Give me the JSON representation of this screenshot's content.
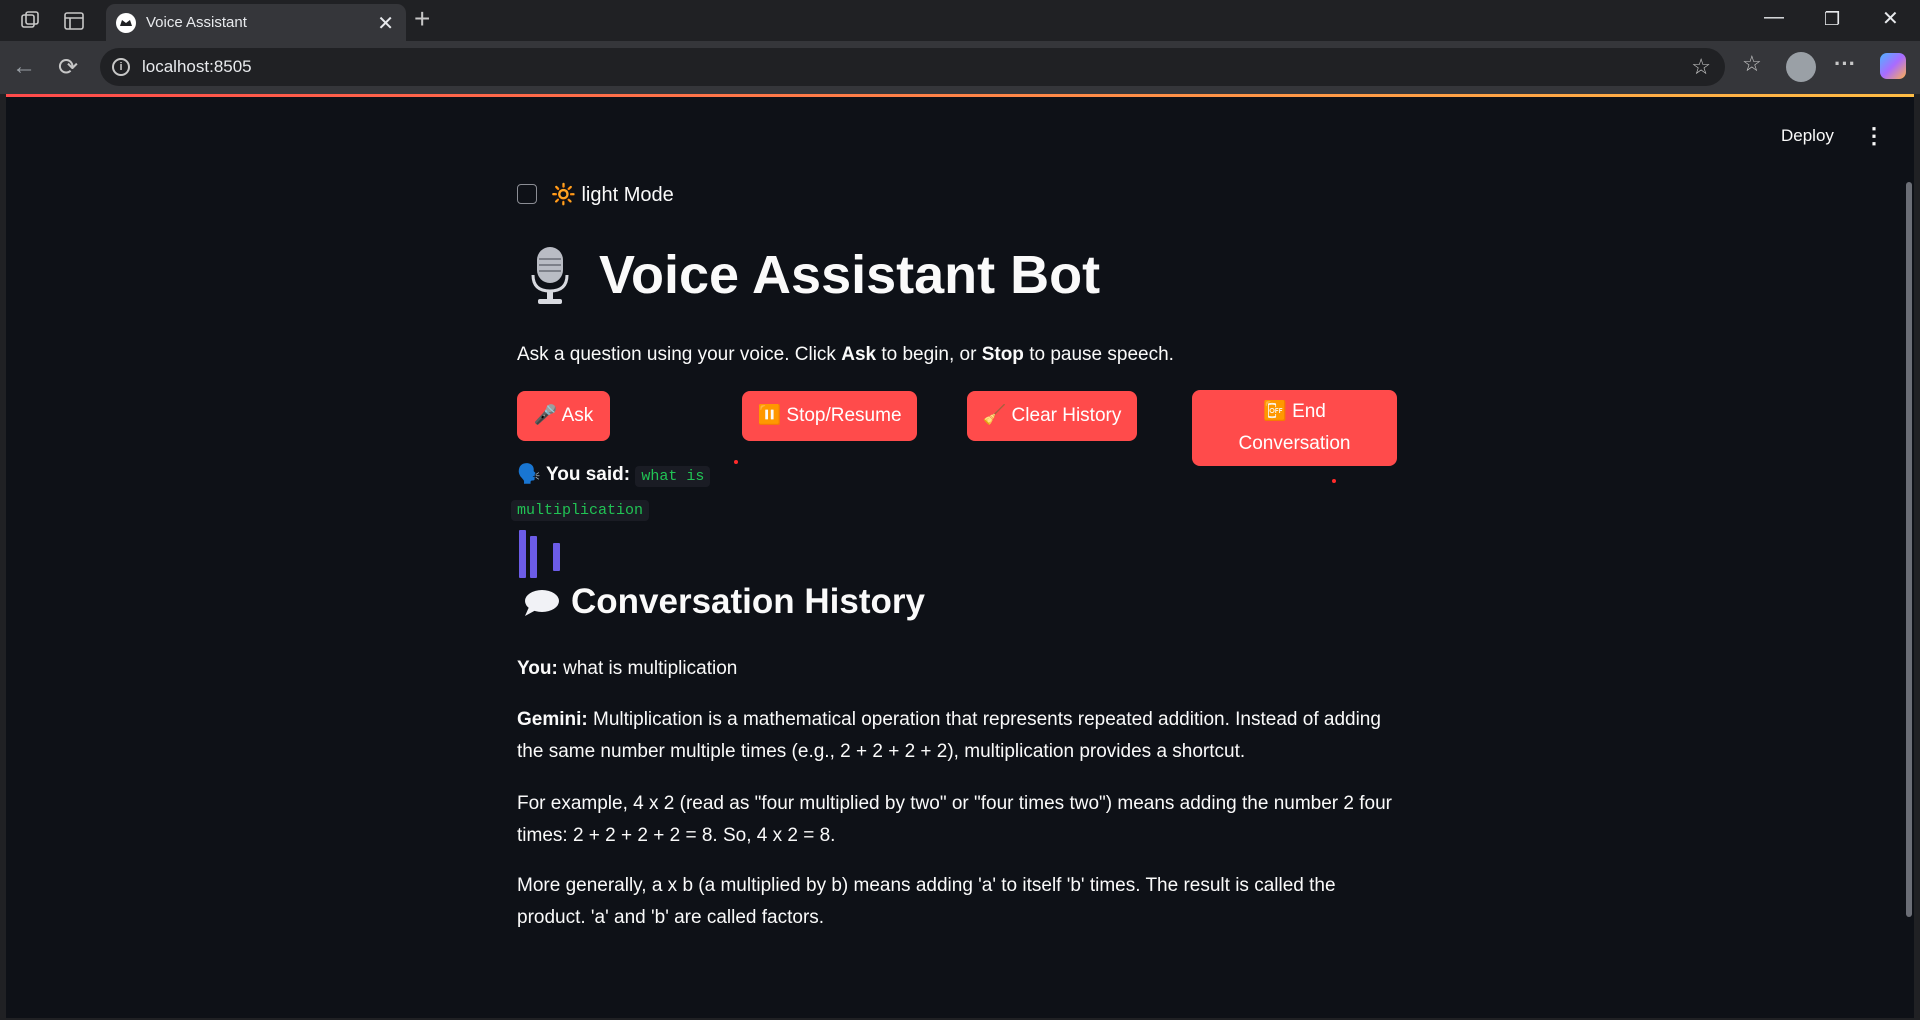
{
  "browser": {
    "tab_title": "Voice Assistant",
    "url": "localhost:8505"
  },
  "app": {
    "deploy_label": "Deploy",
    "light_mode_label": "🔆 light Mode",
    "title": "Voice Assistant Bot",
    "intro": {
      "pre": "Ask a question using your voice. Click ",
      "ask": "Ask",
      "mid": " to begin, or ",
      "stop": "Stop",
      "post": " to pause speech."
    },
    "buttons": {
      "ask": "🎤 Ask",
      "stop_resume": "⏸️ Stop/Resume",
      "clear_history": "🧹 Clear History",
      "end_icon": "📴",
      "end_line1": "End",
      "end_line2": "Conversation"
    },
    "you_said": {
      "icon": "🗣️",
      "label": "You said:",
      "value_line1": "what is",
      "value_line2": "multiplication"
    },
    "history": {
      "icon": "💬",
      "heading": "Conversation History",
      "you_label": "You:",
      "you_text": " what is multiplication",
      "gemini_label": "Gemini:",
      "gemini_text": " Multiplication is a mathematical operation that represents repeated addition. Instead of adding the same number multiple times (e.g., 2 + 2 + 2 + 2), multiplication provides a shortcut.",
      "para2": "For example, 4 x 2 (read as \"four multiplied by two\" or \"four times two\") means adding the number 2 four times: 2 + 2 + 2 + 2 = 8. So, 4 x 2 = 8.",
      "para3": "More generally, a x b (a multiplied by b) means adding 'a' to itself 'b' times. The result is called the product. 'a' and 'b' are called factors."
    },
    "colors": {
      "accent": "#ff4b4b",
      "background": "#0e1117",
      "code_text": "#21c354",
      "bars": "#6c5ce7"
    }
  }
}
